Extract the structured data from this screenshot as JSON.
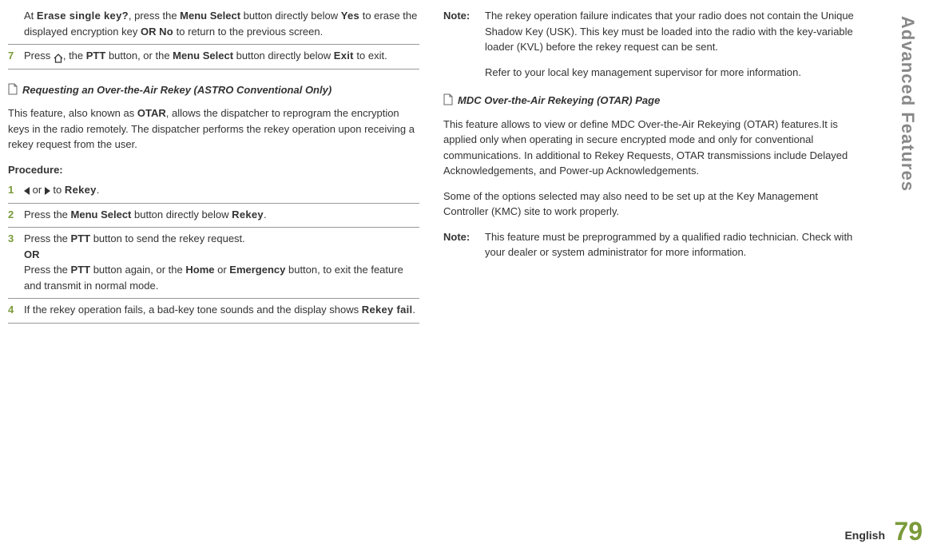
{
  "sidebar": {
    "title": "Advanced Features",
    "page_number": "79",
    "language": "English"
  },
  "left": {
    "intro_step": {
      "pre": "At ",
      "ui1": "Erase single key?",
      "mid1": ", press the ",
      "b1": "Menu Select",
      "mid2": " button directly below ",
      "ui2": "Yes",
      "mid3": " to erase the displayed encryption key ",
      "b2": "OR",
      "mid4": " ",
      "ui3": "No",
      "end": " to return to the previous screen."
    },
    "step7": {
      "num": "7",
      "pre": "Press ",
      "mid0": ", the ",
      "b1": "PTT",
      "mid1": " button, or the ",
      "b2": "Menu Select",
      "mid2": " button directly below ",
      "ui1": "Exit",
      "end": " to exit."
    },
    "subheading": "Requesting an Over-the-Air Rekey (ASTRO Conventional Only)",
    "paragraph1_pre": "This feature, also known as ",
    "paragraph1_b": "OTAR",
    "paragraph1_post": ", allows the dispatcher to reprogram the encryption keys in the radio remotely. The dispatcher performs the rekey operation upon receiving a rekey request from the user.",
    "procedure_label": "Procedure:",
    "step1": {
      "num": "1",
      "or": " or ",
      "to": " to ",
      "ui": "Rekey",
      "end": "."
    },
    "step2": {
      "num": "2",
      "pre": "Press the ",
      "b1": "Menu Select",
      "mid": " button directly below ",
      "ui": "Rekey",
      "end": "."
    },
    "step3": {
      "num": "3",
      "line1_pre": "Press the ",
      "line1_b": "PTT",
      "line1_post": " button to send the rekey request.",
      "or": "OR",
      "line2_pre": "Press the ",
      "line2_b1": "PTT",
      "line2_mid1": " button again, or the ",
      "line2_b2": "Home",
      "line2_mid2": " or ",
      "line2_b3": "Emergency",
      "line2_post": " button, to exit the feature and transmit in normal mode."
    },
    "step4": {
      "num": "4",
      "pre": "If the rekey operation fails, a bad-key tone sounds and the display shows ",
      "ui": "Rekey fail",
      "end": "."
    }
  },
  "right": {
    "note1_label": "Note:",
    "note1_p1": "The rekey operation failure indicates that your radio does not contain the Unique Shadow Key (USK). This key must be loaded into the radio with the key-variable loader (KVL) before the rekey request can be sent.",
    "note1_p2": "Refer to your local key management supervisor for more information.",
    "subheading": "MDC Over-the-Air Rekeying (OTAR) Page",
    "paragraph1": "This feature allows to view or define MDC Over-the-Air Rekeying (OTAR) features.It is applied only when operating in secure encrypted mode and only for conventional communications. In additional to Rekey Requests, OTAR transmissions include Delayed Acknowledgements, and Power-up Acknowledgements.",
    "paragraph2": "Some of the options selected may also need to be set up at the Key Management Controller (KMC) site to work properly.",
    "note2_label": "Note:",
    "note2_body": "This feature must be preprogrammed by a qualified radio technician. Check with your dealer or system administrator for more information."
  }
}
